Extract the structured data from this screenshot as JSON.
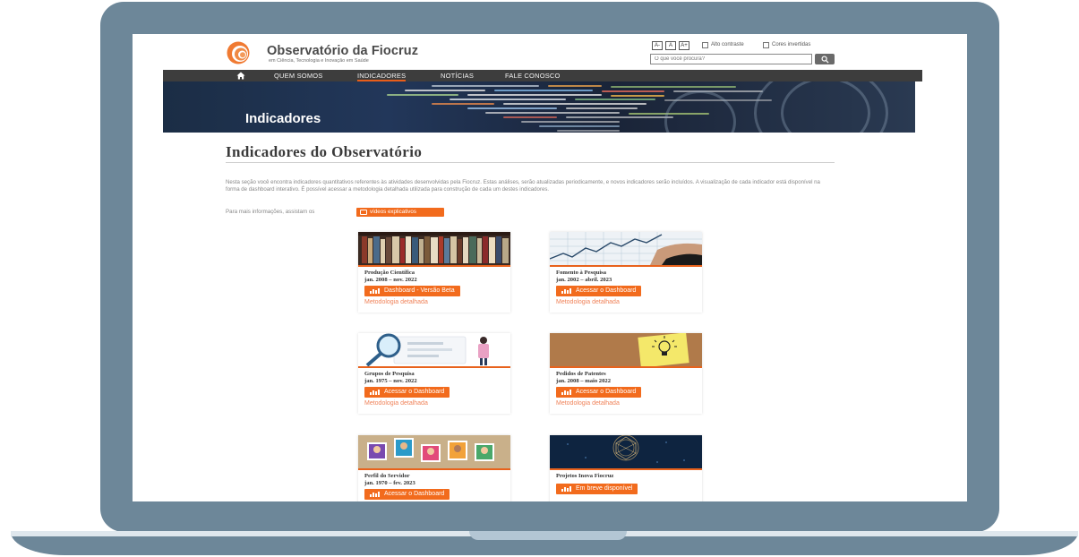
{
  "site": {
    "logo_title": "Observatório da Fiocruz",
    "logo_subtitle": "em Ciência, Tecnologia e Inovação em Saúde",
    "accessibility": {
      "font_decrease": "A-",
      "font_default": "A",
      "font_increase": "A+",
      "high_contrast": "Alto contraste",
      "inverted_colors": "Cores invertidas"
    },
    "search_placeholder": "O que você procura?"
  },
  "nav": {
    "items": [
      {
        "label": "QUEM SOMOS"
      },
      {
        "label": "INDICADORES",
        "active": true
      },
      {
        "label": "NOTÍCIAS"
      },
      {
        "label": "FALE CONOSCO"
      }
    ]
  },
  "banner": {
    "title": "Indicadores"
  },
  "content": {
    "page_title": "Indicadores do Observatório",
    "intro": "Nesta seção você encontra indicadores quantitativos referentes às atividades desenvolvidas pela Fiocruz. Estas análises, serão atualizadas periodicamente, e novos indicadores serão incluídos. A visualização de cada indicador está disponível na forma de dashboard interativo. É possível acessar a metodologia detalhada utilizada para construção de cada um destes indicadores.",
    "more_info": "Para mais informações, assistam os",
    "video_button": "vídeos explicativos"
  },
  "cards": [
    {
      "title": "Produção Científica",
      "period": "jan. 2008 – nov. 2022",
      "button": "Dashboard - Versão Beta",
      "link": "Metodologia detalhada"
    },
    {
      "title": "Fomento à Pesquisa",
      "period": "jan. 2002 – abril. 2023",
      "button": "Acessar o Dashboard",
      "link": "Metodologia detalhada"
    },
    {
      "title": "Grupos de Pesquisa",
      "period": "jan. 1975 – nov. 2022",
      "button": "Acessar o Dashboard",
      "link": "Metodologia detalhada"
    },
    {
      "title": "Pedidos de Patentes",
      "period": "jan. 2008 – maio 2022",
      "button": "Acessar o Dashboard",
      "link": "Metodologia detalhada"
    },
    {
      "title": "Perfil do Servidor",
      "period": "jan. 1970 – fev. 2023",
      "button": "Acessar o Dashboard"
    },
    {
      "title": "Projetos Inova Fiocruz",
      "button": "Em breve disponível"
    }
  ],
  "colors": {
    "accent": "#f26b1d",
    "nav_bg": "#3d3d3d",
    "frame": "#6d8799",
    "link": "#f0835a"
  },
  "icons": [
    "home-icon",
    "search-icon",
    "video-icon",
    "dashboard-chart-icon"
  ]
}
